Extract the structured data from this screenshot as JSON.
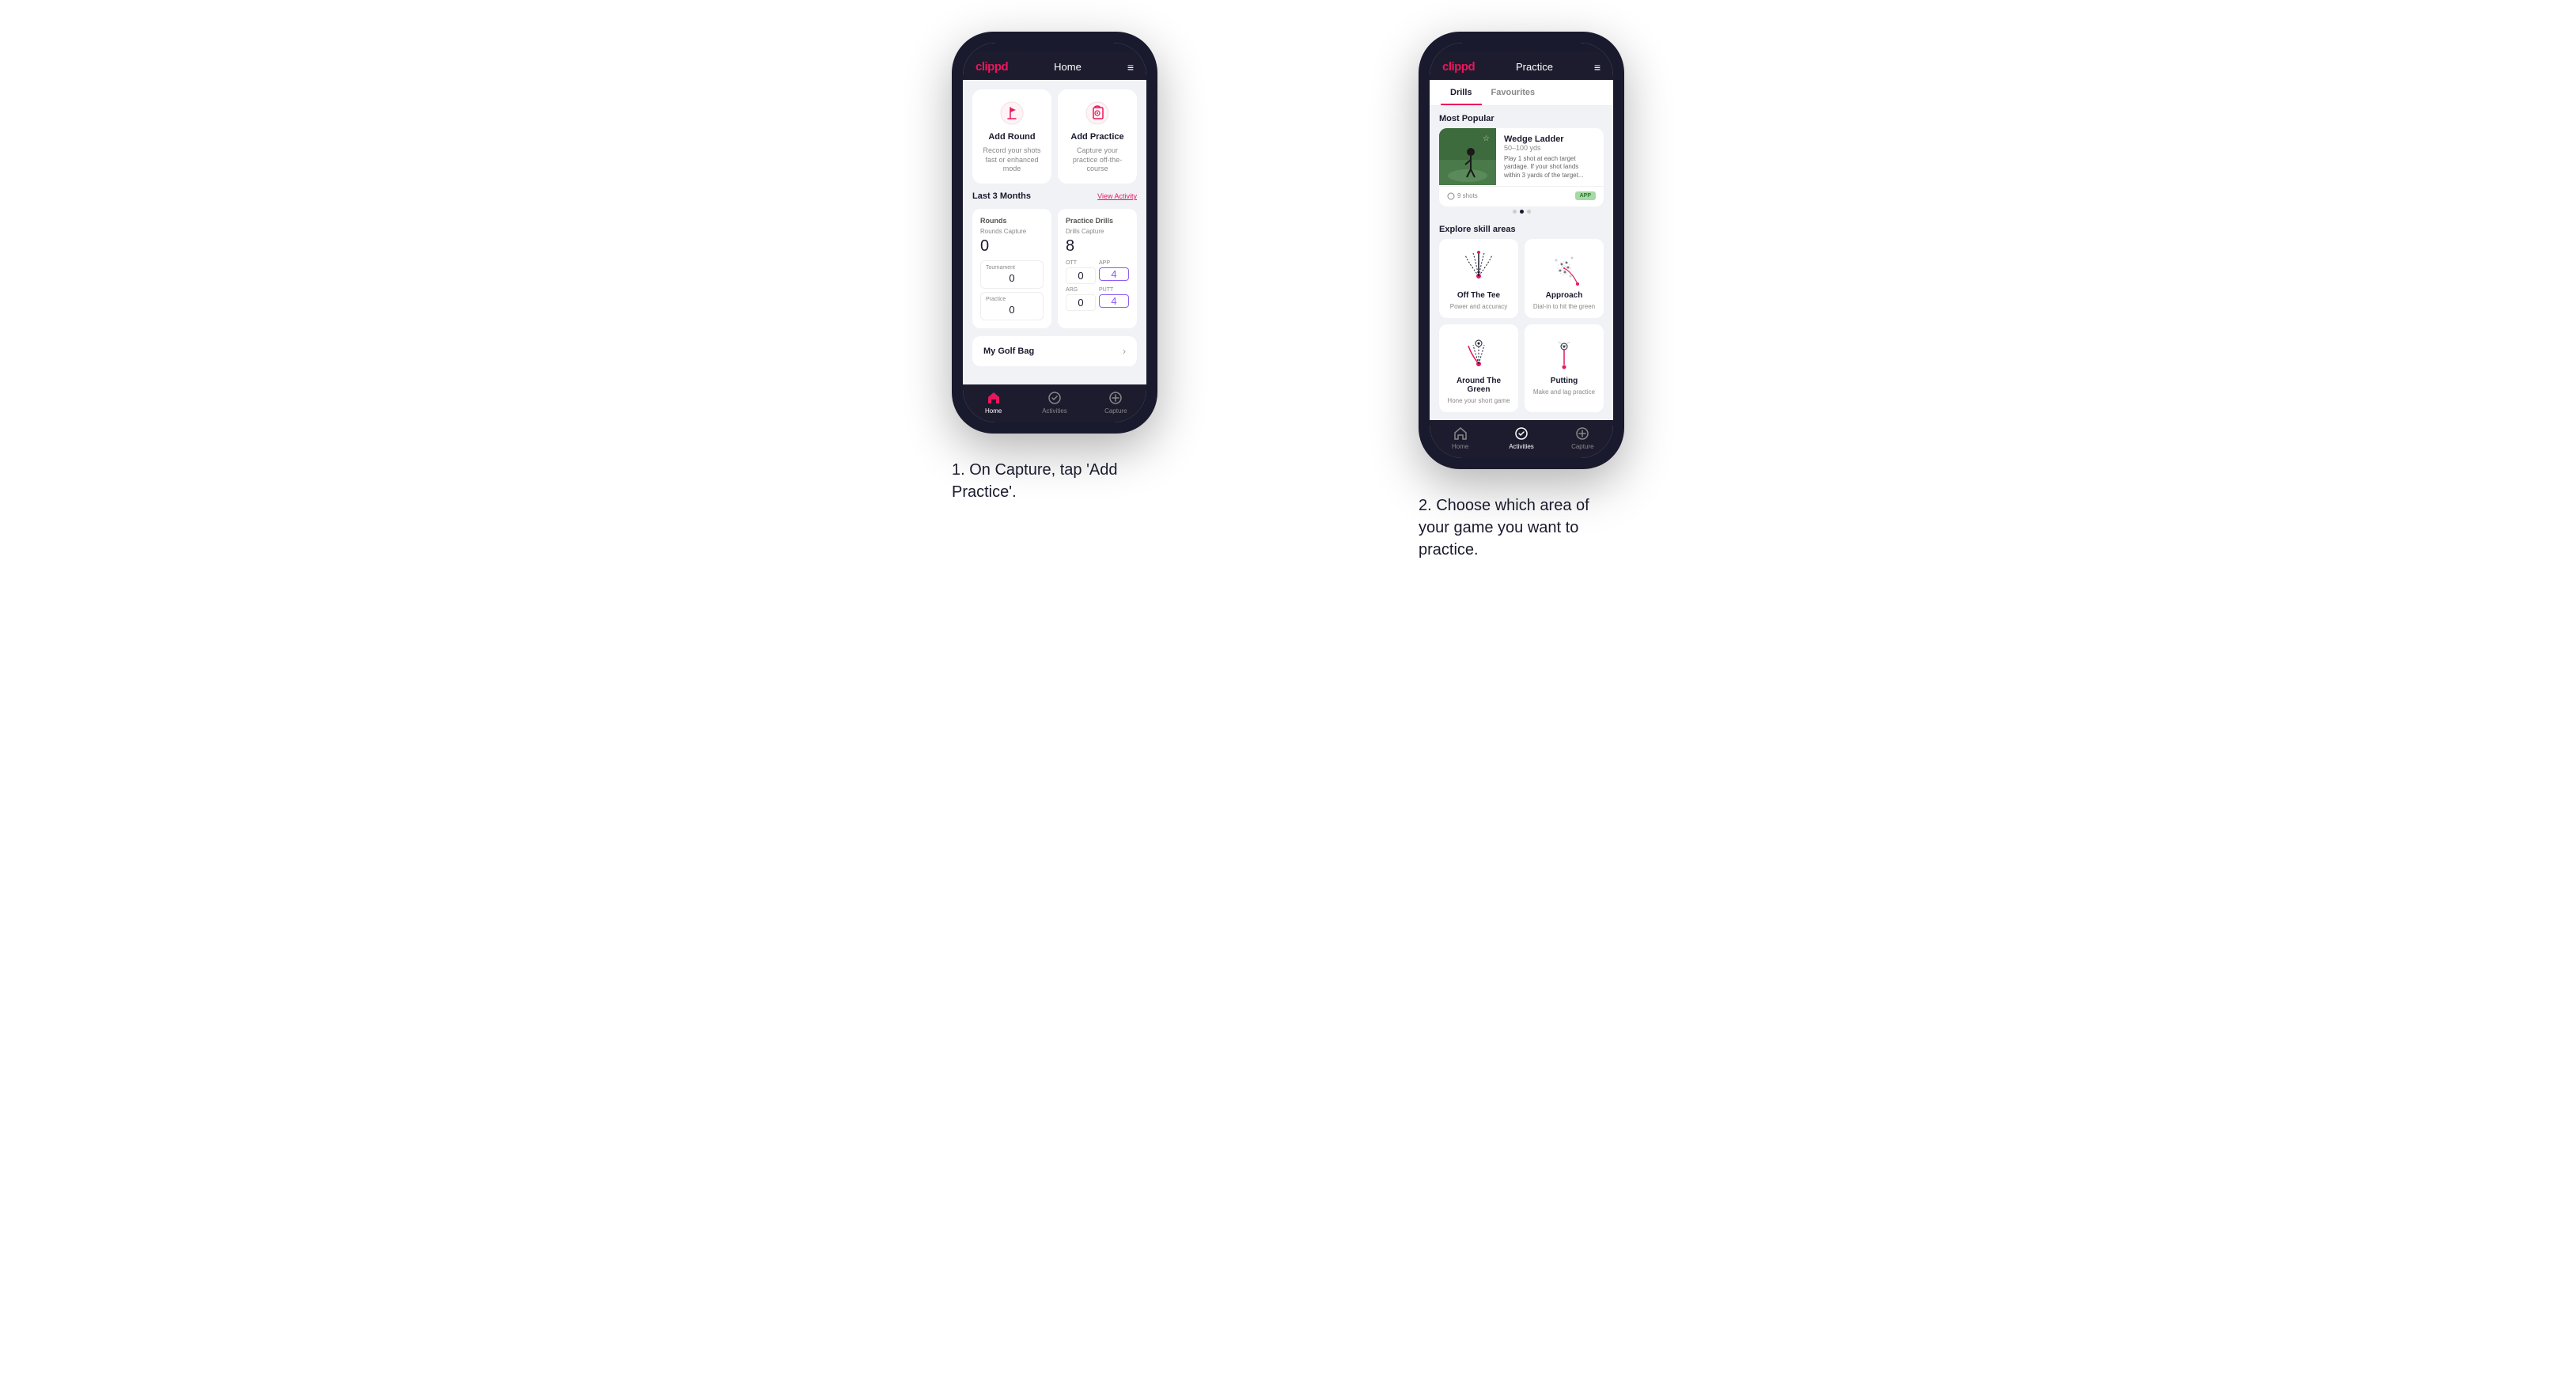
{
  "page": {
    "background": "#ffffff"
  },
  "phone1": {
    "header": {
      "logo": "clippd",
      "title": "Home",
      "menu_icon": "≡"
    },
    "add_round_card": {
      "title": "Add Round",
      "subtitle": "Record your shots fast or enhanced mode",
      "icon": "flag"
    },
    "add_practice_card": {
      "title": "Add Practice",
      "subtitle": "Capture your practice off-the-course",
      "icon": "target"
    },
    "stats_section": {
      "period": "Last 3 Months",
      "view_activity": "View Activity",
      "rounds_box": {
        "title": "Rounds",
        "capture_label": "Rounds Capture",
        "value": "0",
        "sub_items": [
          {
            "label": "Tournament",
            "value": "0",
            "highlighted": false
          },
          {
            "label": "Practice",
            "value": "0",
            "highlighted": false
          }
        ]
      },
      "drills_box": {
        "title": "Practice Drills",
        "capture_label": "Drills Capture",
        "value": "8",
        "sub_labels": [
          "OTT",
          "APP",
          "ARG",
          "PUTT"
        ],
        "sub_values": [
          "0",
          "4",
          "0",
          "4"
        ],
        "highlighted": [
          false,
          true,
          false,
          true
        ]
      }
    },
    "golf_bag": {
      "label": "My Golf Bag",
      "chevron": "›"
    },
    "bottom_nav": {
      "items": [
        {
          "label": "Home",
          "active": true
        },
        {
          "label": "Activities",
          "active": false
        },
        {
          "label": "Capture",
          "active": false
        }
      ]
    }
  },
  "phone2": {
    "header": {
      "logo": "clippd",
      "title": "Practice",
      "menu_icon": "≡"
    },
    "tabs": [
      {
        "label": "Drills",
        "active": true
      },
      {
        "label": "Favourites",
        "active": false
      }
    ],
    "most_popular": {
      "section_title": "Most Popular",
      "card": {
        "title": "Wedge Ladder",
        "yardage": "50–100 yds",
        "description": "Play 1 shot at each target yardage. If your shot lands within 3 yards of the target...",
        "shots": "9 shots",
        "badge": "APP"
      },
      "dots": [
        false,
        true,
        false
      ]
    },
    "explore": {
      "section_title": "Explore skill areas",
      "skills": [
        {
          "title": "Off The Tee",
          "subtitle": "Power and accuracy",
          "diagram_type": "arc"
        },
        {
          "title": "Approach",
          "subtitle": "Dial-in to hit the green",
          "diagram_type": "scatter"
        },
        {
          "title": "Around The Green",
          "subtitle": "Hone your short game",
          "diagram_type": "arc_low"
        },
        {
          "title": "Putting",
          "subtitle": "Make and lag practice",
          "diagram_type": "putting"
        }
      ]
    },
    "bottom_nav": {
      "items": [
        {
          "label": "Home",
          "active": false
        },
        {
          "label": "Activities",
          "active": true
        },
        {
          "label": "Capture",
          "active": false
        }
      ]
    }
  },
  "captions": {
    "caption1": "1. On Capture, tap 'Add Practice'.",
    "caption2": "2. Choose which area of your game you want to practice."
  }
}
